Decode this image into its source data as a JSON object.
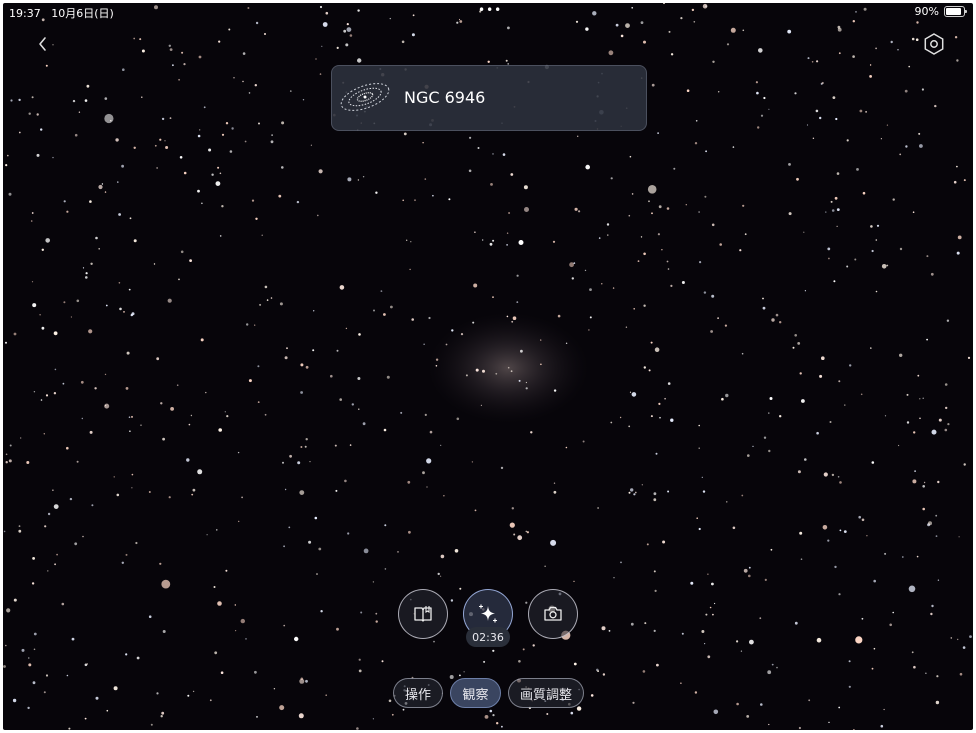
{
  "status_bar": {
    "time": "19:37",
    "date": "10月6日(日)",
    "dots": "•••",
    "battery_percent": "90%",
    "battery_level": 0.9
  },
  "header": {
    "back_icon": "chevron-left-icon",
    "settings_icon": "hexagon-settings-icon"
  },
  "target": {
    "name": "NGC 6946",
    "thumbnail_icon": "galaxy-thumbnail-icon"
  },
  "controls": {
    "guide_icon": "book-guide-icon",
    "enhance_icon": "sparkle-icon",
    "capture_icon": "camera-icon",
    "timer": "02:36"
  },
  "tabs": [
    {
      "label": "操作",
      "active": false
    },
    {
      "label": "観察",
      "active": true
    },
    {
      "label": "画質調整",
      "active": false
    }
  ],
  "colors": {
    "sky": "#07050a",
    "active_tab": "#3a4560"
  }
}
